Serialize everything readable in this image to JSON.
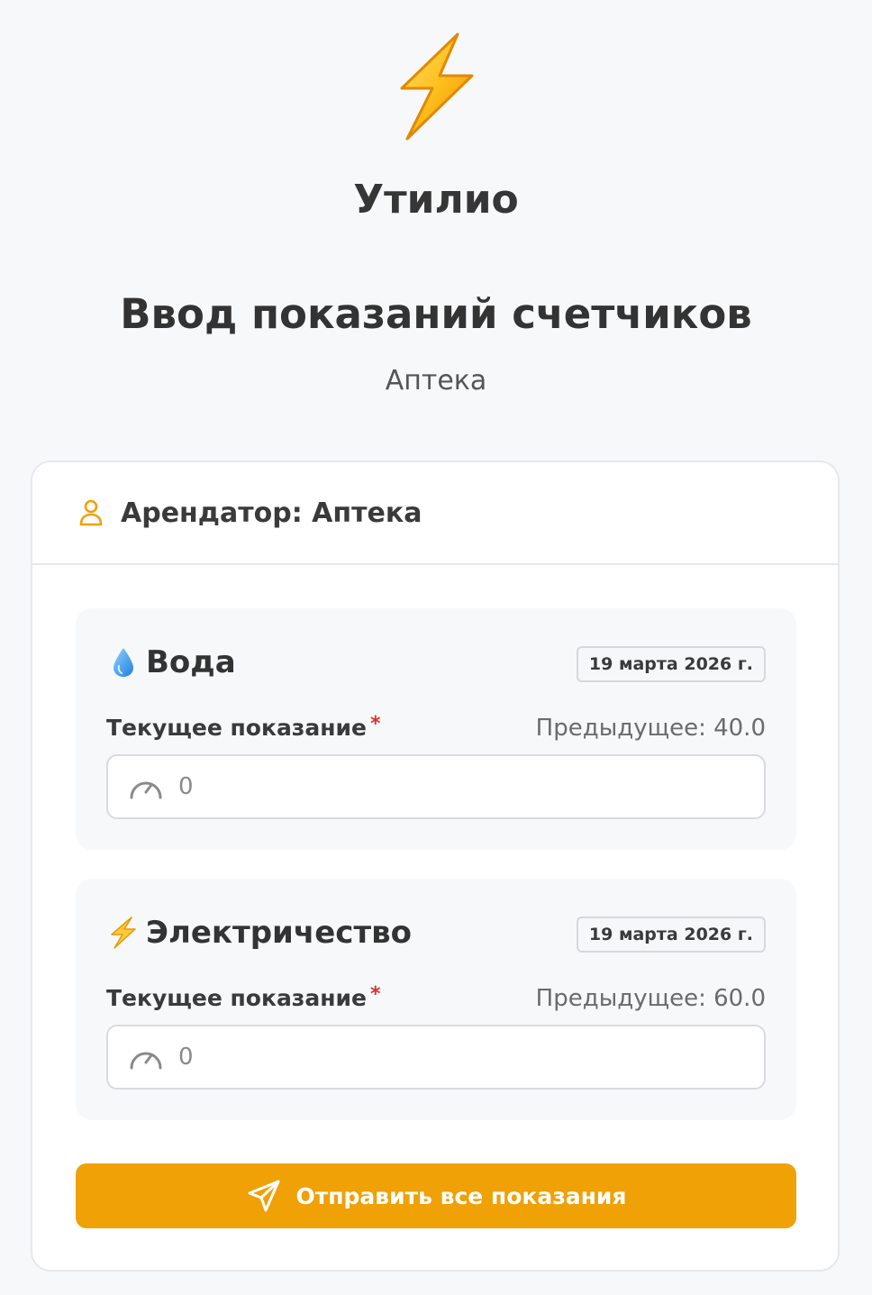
{
  "brand": {
    "name": "Утилио",
    "logo_icon": "lightning-bolt-icon"
  },
  "page": {
    "title": "Ввод показаний счетчиков",
    "subtitle": "Аптека"
  },
  "card": {
    "tenant_text": "Арендатор: Аптека",
    "tenant_icon": "user-icon",
    "meters": [
      {
        "icon": "water-drop-icon",
        "title": "Вода",
        "date": "19 марта 2026 г.",
        "field_label": "Текущее показание",
        "required_mark": "*",
        "previous": "Предыдущее: 40.0",
        "input_value": "",
        "input_placeholder": "0",
        "input_icon": "gauge-icon"
      },
      {
        "icon": "lightning-icon",
        "title": "Электричество",
        "date": "19 марта 2026 г.",
        "field_label": "Текущее показание",
        "required_mark": "*",
        "previous": "Предыдущее: 60.0",
        "input_value": "",
        "input_placeholder": "0",
        "input_icon": "gauge-icon"
      }
    ],
    "submit_label": "Отправить все показания",
    "submit_icon": "send-icon"
  },
  "colors": {
    "accent": "#efa106",
    "background": "#f7f8fa",
    "required": "#d9342b"
  }
}
